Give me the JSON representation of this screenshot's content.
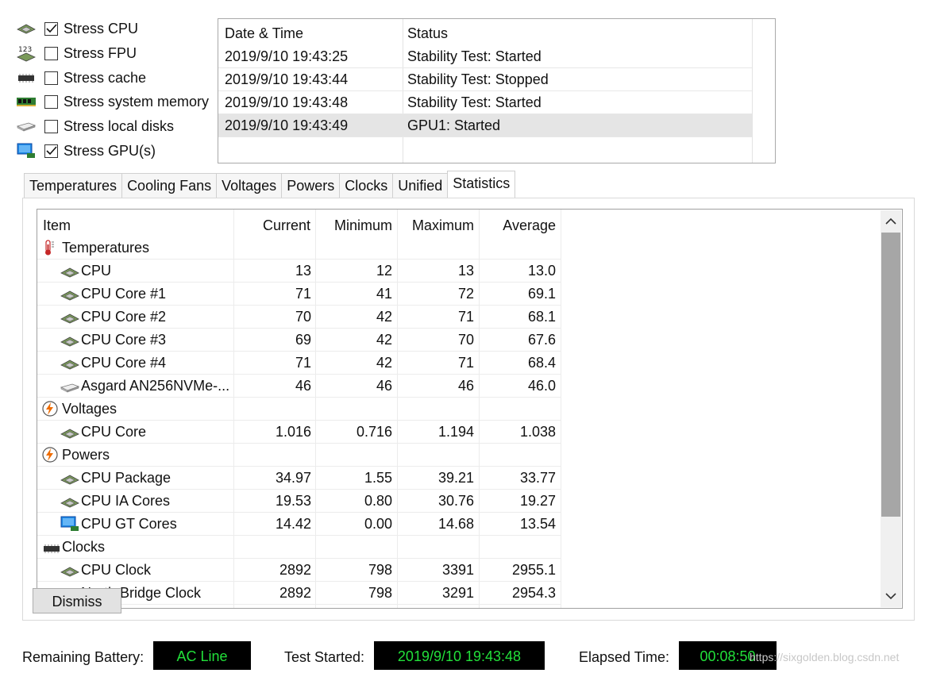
{
  "stress_options": [
    {
      "label": "Stress CPU",
      "checked": true,
      "icon": "cpu-chip-icon"
    },
    {
      "label": "Stress FPU",
      "checked": false,
      "icon": "fpu-123-icon"
    },
    {
      "label": "Stress cache",
      "checked": false,
      "icon": "cache-chip-icon"
    },
    {
      "label": "Stress system memory",
      "checked": false,
      "icon": "memory-module-icon"
    },
    {
      "label": "Stress local disks",
      "checked": false,
      "icon": "disk-drive-icon"
    },
    {
      "label": "Stress GPU(s)",
      "checked": true,
      "icon": "gpu-card-icon"
    }
  ],
  "log": {
    "headers": {
      "date": "Date & Time",
      "status": "Status"
    },
    "rows": [
      {
        "date": "2019/9/10 19:43:25",
        "status": "Stability Test: Started"
      },
      {
        "date": "2019/9/10 19:43:44",
        "status": "Stability Test: Stopped"
      },
      {
        "date": "2019/9/10 19:43:48",
        "status": "Stability Test: Started"
      },
      {
        "date": "2019/9/10 19:43:49",
        "status": "GPU1: Started"
      }
    ]
  },
  "tabs": [
    "Temperatures",
    "Cooling Fans",
    "Voltages",
    "Powers",
    "Clocks",
    "Unified",
    "Statistics"
  ],
  "table": {
    "headers": {
      "item": "Item",
      "current": "Current",
      "minimum": "Minimum",
      "maximum": "Maximum",
      "average": "Average"
    },
    "rows": [
      {
        "group": true,
        "icon": "thermometer-icon",
        "item": "Temperatures",
        "current": "",
        "minimum": "",
        "maximum": "",
        "average": ""
      },
      {
        "group": false,
        "icon": "cpu-chip-icon",
        "item": "CPU",
        "current": "13",
        "minimum": "12",
        "maximum": "13",
        "average": "13.0"
      },
      {
        "group": false,
        "icon": "cpu-chip-icon",
        "item": "CPU Core #1",
        "current": "71",
        "minimum": "41",
        "maximum": "72",
        "average": "69.1"
      },
      {
        "group": false,
        "icon": "cpu-chip-icon",
        "item": "CPU Core #2",
        "current": "70",
        "minimum": "42",
        "maximum": "71",
        "average": "68.1"
      },
      {
        "group": false,
        "icon": "cpu-chip-icon",
        "item": "CPU Core #3",
        "current": "69",
        "minimum": "42",
        "maximum": "70",
        "average": "67.6"
      },
      {
        "group": false,
        "icon": "cpu-chip-icon",
        "item": "CPU Core #4",
        "current": "71",
        "minimum": "42",
        "maximum": "71",
        "average": "68.4"
      },
      {
        "group": false,
        "icon": "disk-drive-icon",
        "item": "Asgard AN256NVMe-...",
        "current": "46",
        "minimum": "46",
        "maximum": "46",
        "average": "46.0"
      },
      {
        "group": true,
        "icon": "lightning-icon",
        "item": "Voltages",
        "current": "",
        "minimum": "",
        "maximum": "",
        "average": ""
      },
      {
        "group": false,
        "icon": "cpu-chip-icon",
        "item": "CPU Core",
        "current": "1.016",
        "minimum": "0.716",
        "maximum": "1.194",
        "average": "1.038"
      },
      {
        "group": true,
        "icon": "lightning-icon",
        "item": "Powers",
        "current": "",
        "minimum": "",
        "maximum": "",
        "average": ""
      },
      {
        "group": false,
        "icon": "cpu-chip-icon",
        "item": "CPU Package",
        "current": "34.97",
        "minimum": "1.55",
        "maximum": "39.21",
        "average": "33.77"
      },
      {
        "group": false,
        "icon": "cpu-chip-icon",
        "item": "CPU IA Cores",
        "current": "19.53",
        "minimum": "0.80",
        "maximum": "30.76",
        "average": "19.27"
      },
      {
        "group": false,
        "icon": "gpu-card-icon",
        "item": "CPU GT Cores",
        "current": "14.42",
        "minimum": "0.00",
        "maximum": "14.68",
        "average": "13.54"
      },
      {
        "group": true,
        "icon": "cache-chip-icon",
        "item": "Clocks",
        "current": "",
        "minimum": "",
        "maximum": "",
        "average": ""
      },
      {
        "group": false,
        "icon": "cpu-chip-icon",
        "item": "CPU Clock",
        "current": "2892",
        "minimum": "798",
        "maximum": "3391",
        "average": "2955.1"
      },
      {
        "group": false,
        "icon": "cpu-chip-icon",
        "item": "North Bridge Clock",
        "current": "2892",
        "minimum": "798",
        "maximum": "3291",
        "average": "2954.3"
      }
    ]
  },
  "dismiss_label": "Dismiss",
  "status": {
    "battery_label": "Remaining Battery:",
    "battery_value": "AC Line",
    "started_label": "Test Started:",
    "started_value": "2019/9/10 19:43:48",
    "elapsed_label": "Elapsed Time:",
    "elapsed_value": "00:08:50"
  },
  "watermark": "https://sixgolden.blog.csdn.net",
  "colors": {
    "led_bg": "#000000",
    "led_text": "#22e03a",
    "selected_row": "#e5e5e5"
  }
}
